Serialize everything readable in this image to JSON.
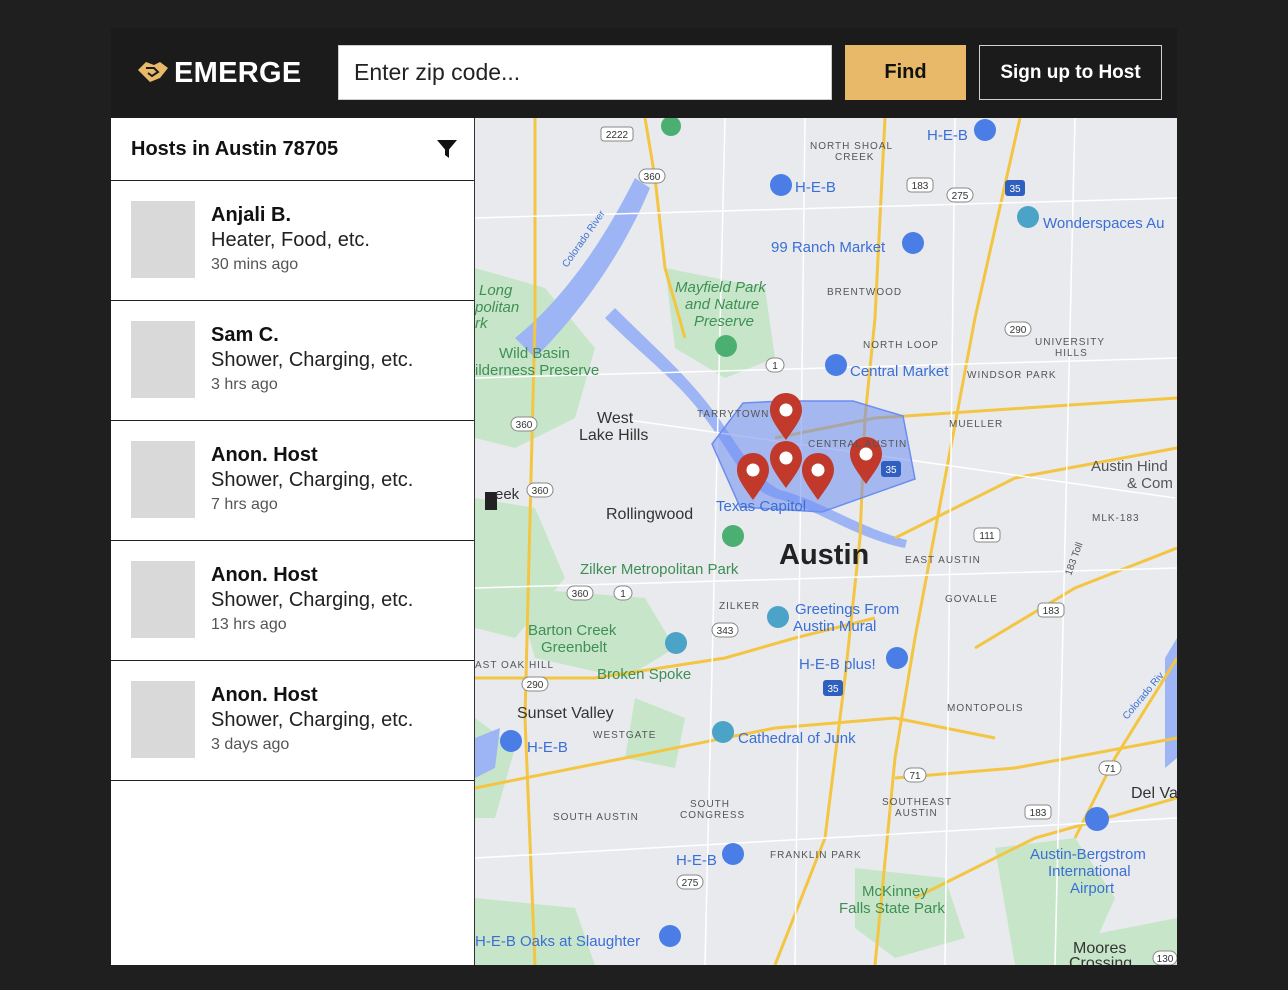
{
  "brand": {
    "name": "EMERGE",
    "accent": "#e9b96a"
  },
  "search": {
    "placeholder": "Enter zip code..."
  },
  "buttons": {
    "find": "Find",
    "host": "Sign up to Host"
  },
  "sidebar": {
    "title": "Hosts in Austin 78705",
    "filter_icon": "filter-icon",
    "hosts": [
      {
        "name": "Anjali B.",
        "services": "Heater, Food, etc.",
        "time": "30 mins ago"
      },
      {
        "name": "Sam C.",
        "services": "Shower, Charging, etc.",
        "time": "3 hrs ago"
      },
      {
        "name": "Anon. Host",
        "services": "Shower, Charging, etc.",
        "time": "7 hrs ago"
      },
      {
        "name": "Anon. Host",
        "services": "Shower, Charging, etc.",
        "time": "13 hrs ago"
      },
      {
        "name": "Anon. Host",
        "services": "Shower, Charging, etc.",
        "time": "3 days ago"
      }
    ]
  },
  "map": {
    "labels": {
      "north_shoal_creek_1": "NORTH SHOAL",
      "north_shoal_creek_2": "CREEK",
      "heb_1": "H-E-B",
      "heb_2": "H-E-B",
      "wonderspaces": "Wonderspaces Au",
      "ranch_market": "99 Ranch Market",
      "brentwood": "BRENTWOOD",
      "long_1": "Long",
      "long_2": "politan",
      "long_3": "rk",
      "mayfield_1": "Mayfield Park",
      "mayfield_2": "and Nature",
      "mayfield_3": "Preserve",
      "north_loop": "NORTH LOOP",
      "university_1": "UNIVERSITY",
      "university_2": "HILLS",
      "wild_basin_1": "Wild Basin",
      "wild_basin_2": "ilderness Preserve",
      "central_market": "Central Market",
      "windsor_park": "WINDSOR PARK",
      "west_lake_1": "West",
      "west_lake_2": "Lake Hills",
      "tarrytown": "TARRYTOWN",
      "mueller": "MUELLER",
      "central_austin": "CENTRAL AUSTIN",
      "austin_hind_1": "Austin Hind",
      "austin_hind_2": "& Com",
      "creek": "eek",
      "rollingwood": "Rollingwood",
      "texas_capitol": "Texas Capitol",
      "mlk": "MLK-183",
      "austin": "Austin",
      "east_austin": "EAST AUSTIN",
      "zilker_park": "Zilker Metropolitan Park",
      "govalle": "GOVALLE",
      "zilker": "ZILKER",
      "greetings_1": "Greetings From",
      "greetings_2": "Austin Mural",
      "barton_1": "Barton Creek",
      "barton_2": "Greenbelt",
      "east_oak_hill": "AST OAK HILL",
      "broken_spoke": "Broken Spoke",
      "heb_plus": "H-E-B plus!",
      "sunset_valley": "Sunset Valley",
      "montopolis": "MONTOPOLIS",
      "westgate": "WESTGATE",
      "heb_3": "H-E-B",
      "cathedral": "Cathedral of Junk",
      "del_valle": "Del Va",
      "south_congress_1": "SOUTH",
      "south_congress_2": "CONGRESS",
      "southeast_1": "SOUTHEAST",
      "southeast_2": "AUSTIN",
      "south_austin": "SOUTH AUSTIN",
      "heb_4": "H-E-B",
      "franklin_park": "FRANKLIN PARK",
      "airport_1": "Austin-Bergstrom",
      "airport_2": "International",
      "airport_3": "Airport",
      "mckinney_1": "McKinney",
      "mckinney_2": "Falls State Park",
      "heb_oaks": "H-E-B Oaks at Slaughter",
      "moores_1": "Moores",
      "moores_2": "Crossing",
      "colorado_river": "Colorado River",
      "colorado_river_2": "Colorado Riv",
      "toll_183": "183 Toll"
    },
    "shields": [
      "2222",
      "360",
      "183",
      "275",
      "35",
      "290",
      "1",
      "360",
      "35",
      "360",
      "111",
      "360",
      "1",
      "343",
      "183",
      "290",
      "35",
      "71",
      "71",
      "183",
      "275",
      "130"
    ],
    "pin_color": "#c0392b",
    "area_color": "#6d8cf0"
  }
}
